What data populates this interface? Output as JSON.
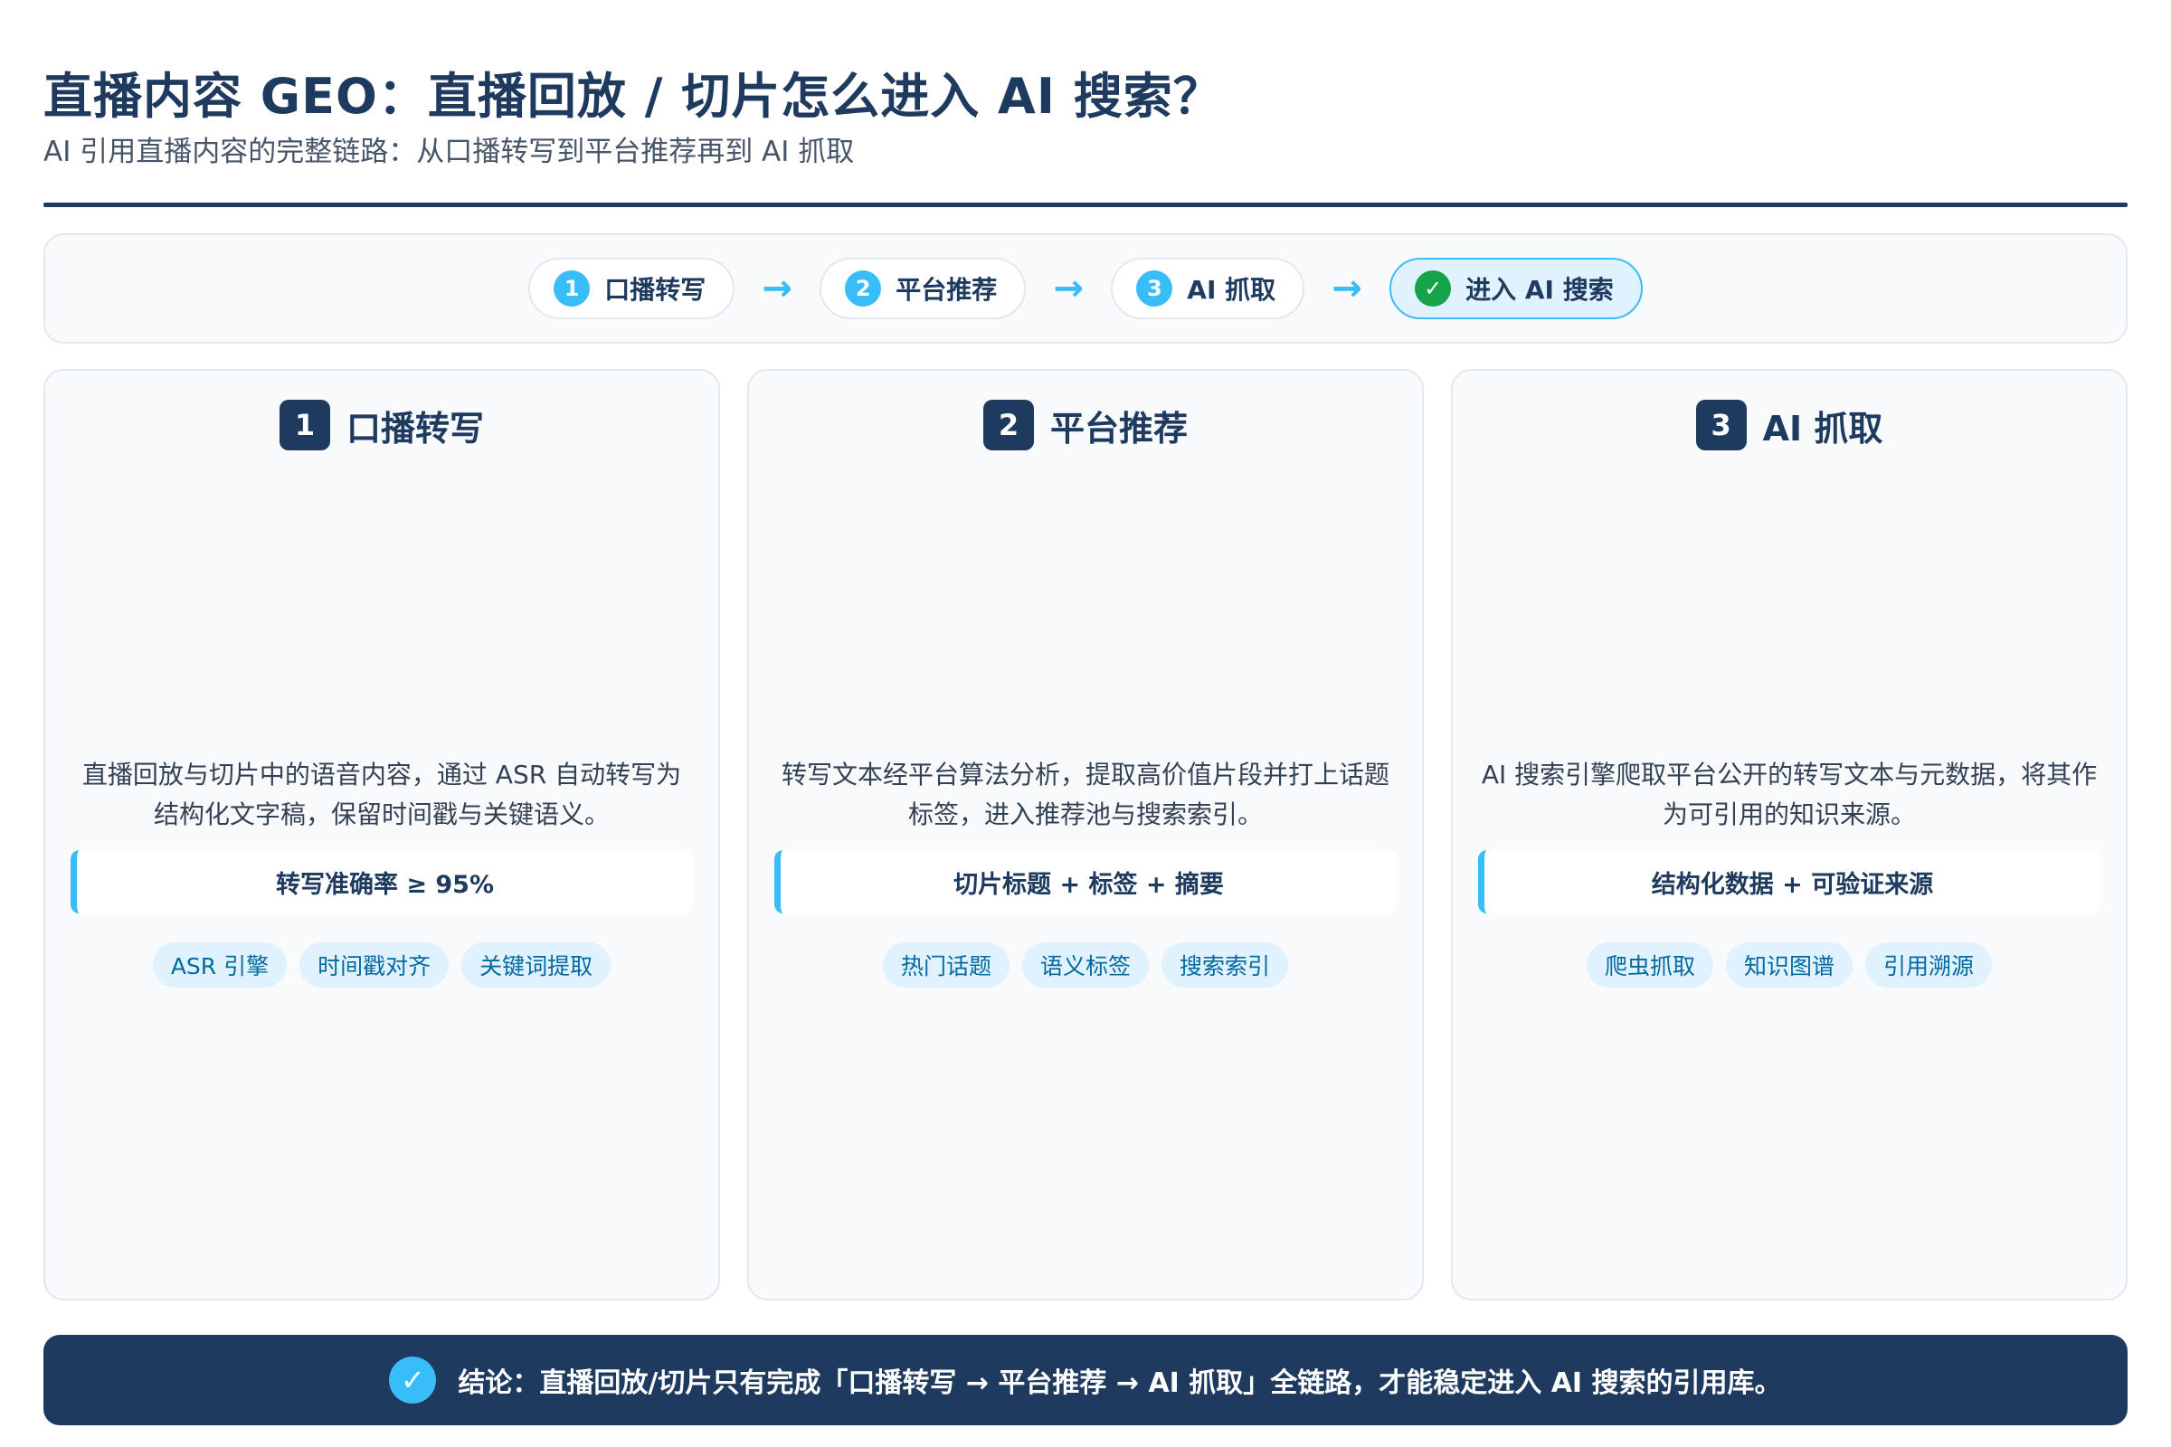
{
  "header": {
    "title": "直播内容 GEO：直播回放 / 切片怎么进入 AI 搜索？",
    "subtitle": "AI 引用直播内容的完整链路：从口播转写到平台推荐再到 AI 抓取"
  },
  "flow": {
    "steps": [
      {
        "num": "1",
        "label": "口播转写"
      },
      {
        "num": "2",
        "label": "平台推荐"
      },
      {
        "num": "3",
        "label": "AI 抓取"
      }
    ],
    "final": {
      "icon": "✓",
      "label": "进入 AI 搜索"
    },
    "arrow": "→"
  },
  "cards": [
    {
      "num": "1",
      "title": "口播转写",
      "desc": "直播回放与切片中的语音内容，通过 ASR 自动转写为结构化文字稿，保留时间戳与关键语义。",
      "metric": "转写准确率 ≥ 95%",
      "tags": [
        "ASR 引擎",
        "时间戳对齐",
        "关键词提取"
      ]
    },
    {
      "num": "2",
      "title": "平台推荐",
      "desc": "转写文本经平台算法分析，提取高价值片段并打上话题标签，进入推荐池与搜索索引。",
      "metric": "切片标题 + 标签 + 摘要",
      "tags": [
        "热门话题",
        "语义标签",
        "搜索索引"
      ]
    },
    {
      "num": "3",
      "title": "AI 抓取",
      "desc": "AI 搜索引擎爬取平台公开的转写文本与元数据，将其作为可引用的知识来源。",
      "metric": "结构化数据 + 可验证来源",
      "tags": [
        "爬虫抓取",
        "知识图谱",
        "引用溯源"
      ]
    }
  ],
  "conclusion": {
    "icon": "✓",
    "text": "结论：直播回放/切片只有完成「口播转写 → 平台推荐 → AI 抓取」全链路，才能稳定进入 AI 搜索的引用库。"
  },
  "colors": {
    "navy": "#1e3a5f",
    "accent": "#38bdf8",
    "success": "#16a34a",
    "tag_bg": "#e0f2fe",
    "tag_text": "#0369a1"
  }
}
